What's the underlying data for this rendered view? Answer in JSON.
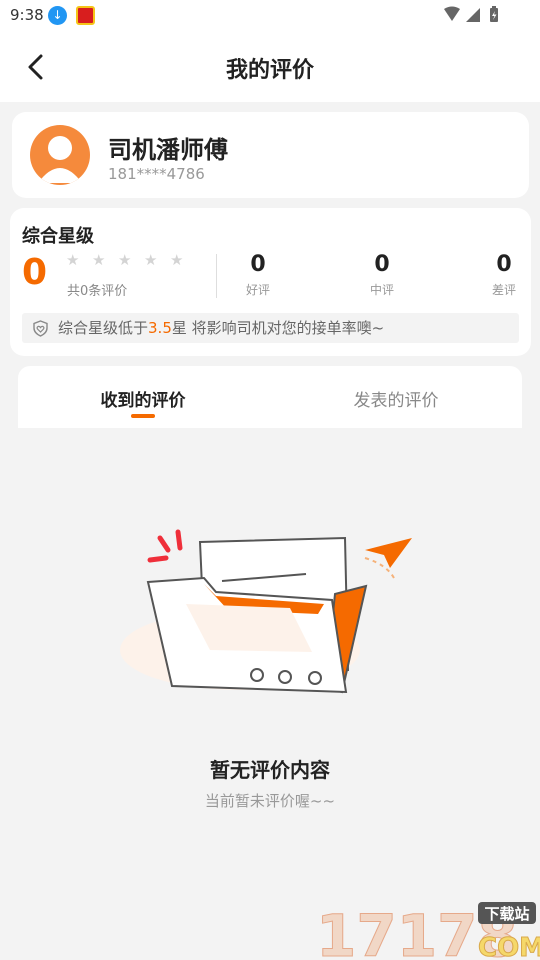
{
  "status_bar": {
    "time": "9:38"
  },
  "header": {
    "title": "我的评价"
  },
  "driver": {
    "name": "司机潘师傅",
    "phone": "181****4786"
  },
  "rating": {
    "heading": "综合星级",
    "score": "0",
    "stars_filled": 0,
    "stars_total": 5,
    "review_count": "共0条评价",
    "stats": [
      {
        "value": "0",
        "label": "好评"
      },
      {
        "value": "0",
        "label": "中评"
      },
      {
        "value": "0",
        "label": "差评"
      }
    ],
    "tip": {
      "before": "综合星级低于",
      "highlight": "3.5",
      "after": "星 将影响司机对您的接单率噢~"
    }
  },
  "tabs": [
    {
      "label": "收到的评价",
      "active": true
    },
    {
      "label": "发表的评价",
      "active": false
    }
  ],
  "empty_state": {
    "title": "暂无评价内容",
    "subtitle": "当前暂未评价喔~~"
  },
  "watermark": {
    "digits": "17178",
    "badge": "下载站",
    "suffix": "COM"
  },
  "colors": {
    "accent": "#f56a00",
    "avatar": "#f58a3c",
    "background": "#f3f3f3"
  }
}
